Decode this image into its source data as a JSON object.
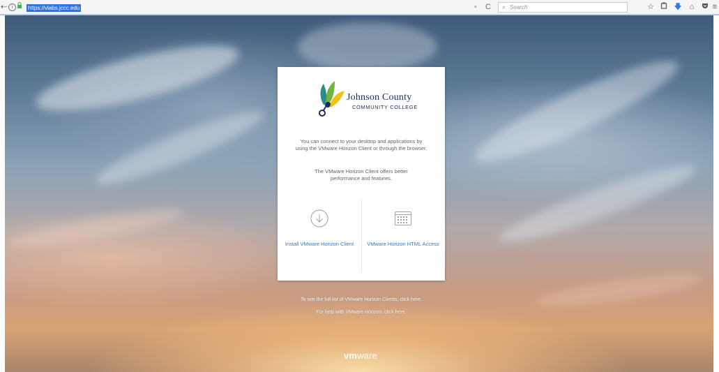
{
  "browser": {
    "url": "https://vlabs.jccc.edu",
    "search_placeholder": "Search",
    "back_glyph": "⇠",
    "reload_glyph": "C",
    "dropdown_glyph": "▾",
    "icons": [
      "star-icon",
      "library-icon",
      "download-icon",
      "home-icon",
      "pocket-icon",
      "menu-icon"
    ]
  },
  "card": {
    "logo_line_1": "Johnson County",
    "logo_line_2": "COMMUNITY COLLEGE",
    "intro": "You can connect to your desktop and applications by using the VMware Horizon Client or through the browser.",
    "client_note": "The VMware Horizon Client offers better performance and features.",
    "install_label": "Install VMware Horizon Client",
    "html_access_label": "VMware Horizon HTML Access"
  },
  "footer": {
    "clients_link": "To see the full list of VMware Horizon Clients, click here.",
    "help_link": "For help with VMware Horizon, click here.",
    "brand_bold": "vm",
    "brand_rest": "ware"
  },
  "colors": {
    "link_blue": "#3a77b8",
    "logo_navy": "#1d2b5a",
    "url_highlight": "#2f73d8"
  }
}
